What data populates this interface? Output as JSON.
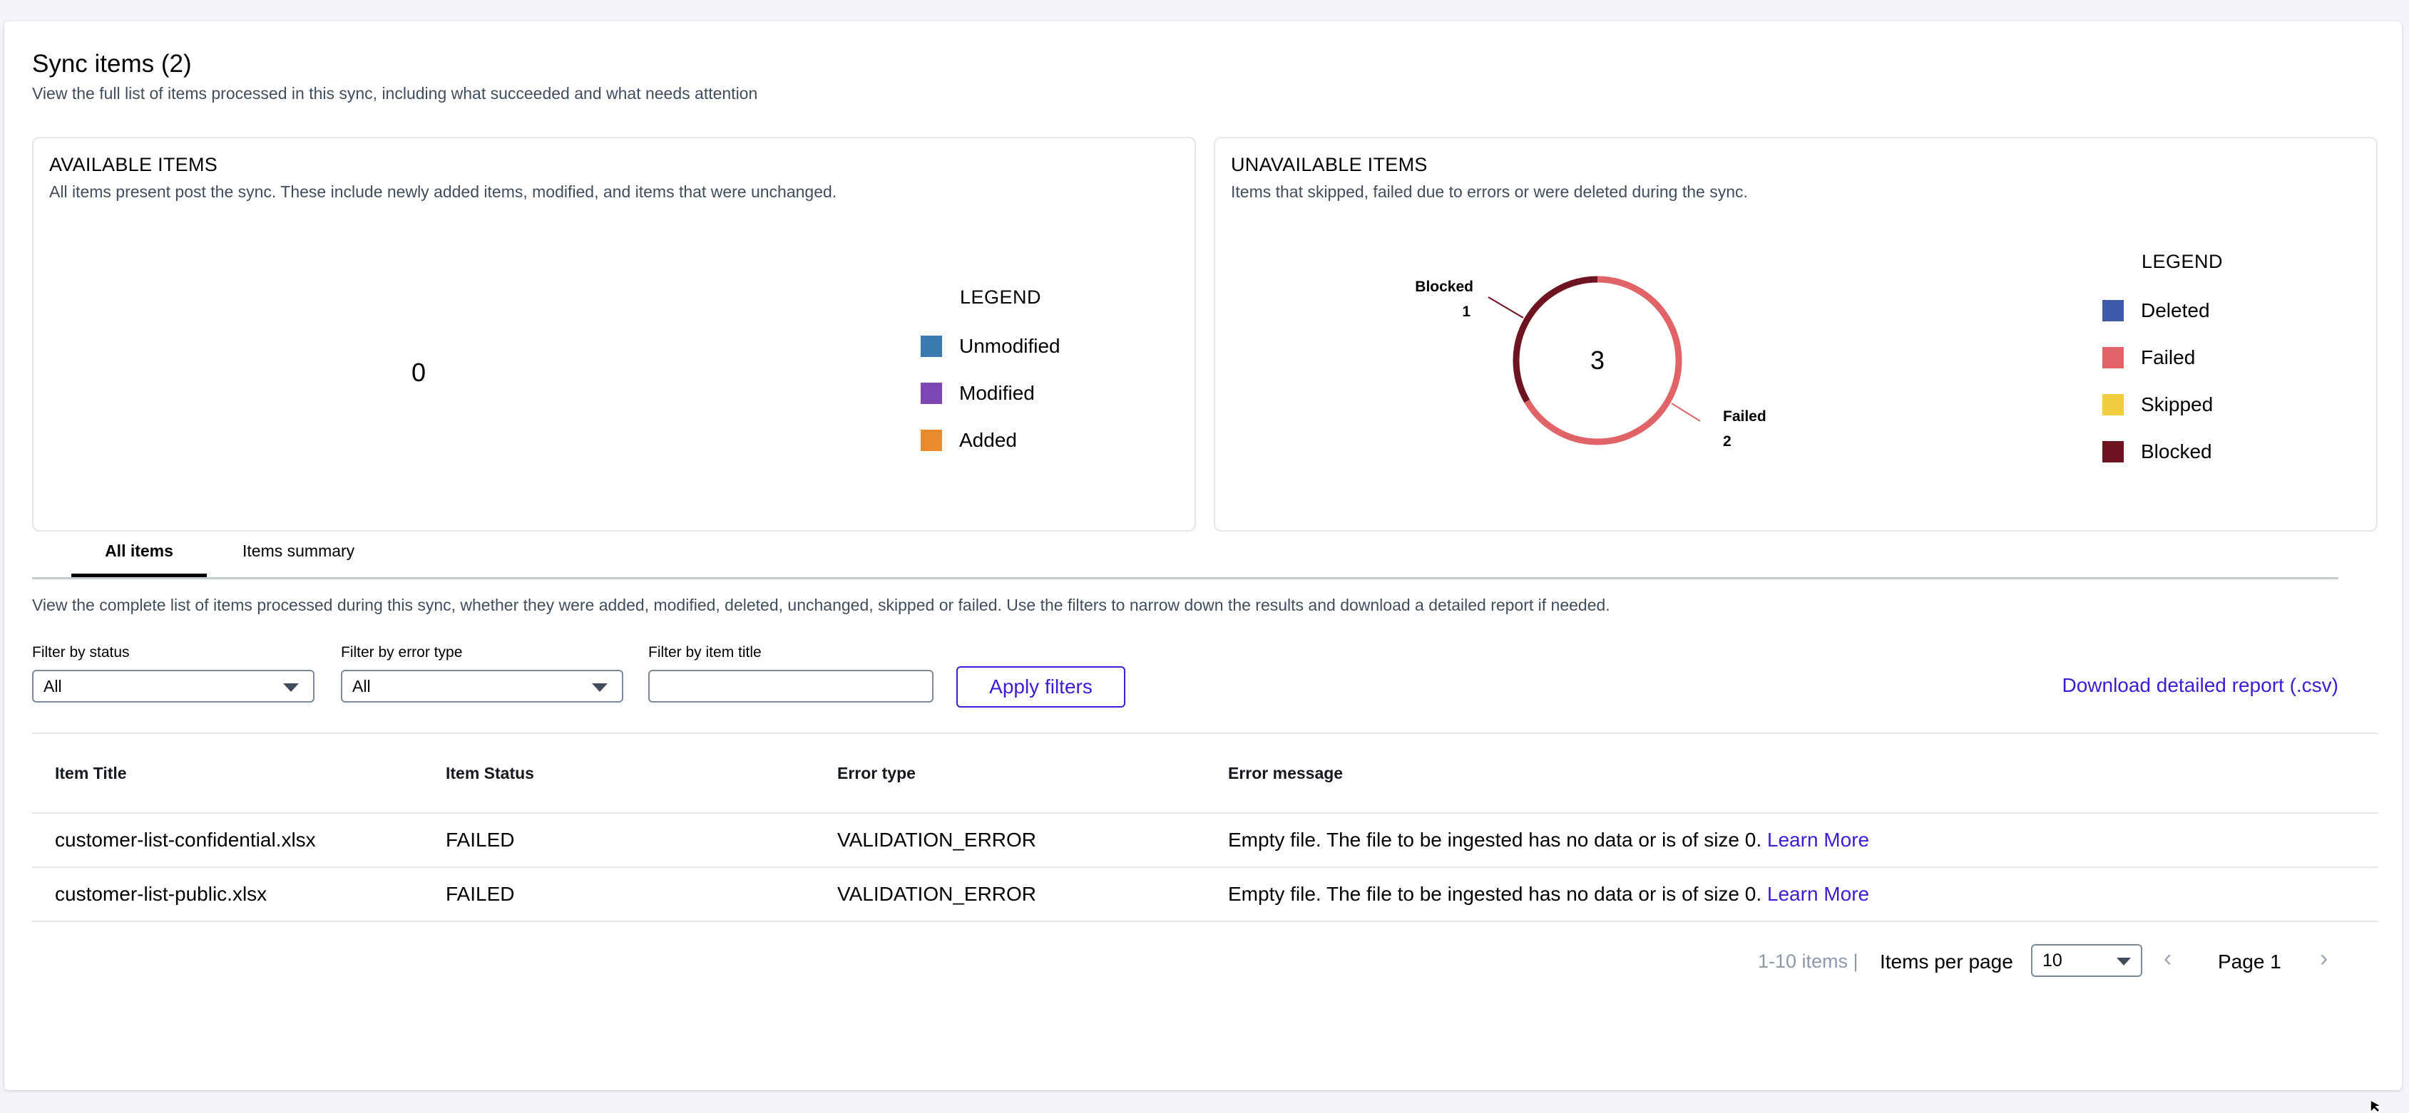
{
  "header": {
    "title": "Sync items (2)",
    "subtitle": "View the full list of items processed in this sync, including what succeeded and what needs attention"
  },
  "available": {
    "heading": "AVAILABLE ITEMS",
    "description": "All items present post the sync. These include newly added items, modified, and items that were unchanged.",
    "total": "0",
    "legend_title": "LEGEND",
    "legend": [
      {
        "label": "Unmodified",
        "color": "#3a79ad"
      },
      {
        "label": "Modified",
        "color": "#7f46b5"
      },
      {
        "label": "Added",
        "color": "#ea8a2e"
      }
    ]
  },
  "unavailable": {
    "heading": "UNAVAILABLE ITEMS",
    "description": "Items that skipped, failed due to errors or were deleted during the sync.",
    "total": "3",
    "legend_title": "LEGEND",
    "legend": [
      {
        "label": "Deleted",
        "color": "#3f5aa8"
      },
      {
        "label": "Failed",
        "color": "#e06467"
      },
      {
        "label": "Skipped",
        "color": "#f2cd40"
      },
      {
        "label": "Blocked",
        "color": "#6e1320"
      }
    ],
    "callouts": {
      "blocked_name": "Blocked",
      "blocked_value": "1",
      "failed_name": "Failed",
      "failed_value": "2"
    }
  },
  "chart_data": {
    "type": "pie",
    "title": "UNAVAILABLE ITEMS",
    "categories": [
      "Deleted",
      "Failed",
      "Skipped",
      "Blocked"
    ],
    "values": [
      0,
      2,
      0,
      1
    ],
    "colors": [
      "#3f5aa8",
      "#e06467",
      "#f2cd40",
      "#6e1320"
    ],
    "center_label": "3",
    "legend_position": "right"
  },
  "tabs": [
    {
      "label": "All items",
      "active": true
    },
    {
      "label": "Items summary",
      "active": false
    }
  ],
  "filters": {
    "description": "View the complete list of items processed during this sync, whether they were added, modified, deleted, unchanged, skipped or failed. Use the filters to narrow down the results and download a detailed report if needed.",
    "status_label": "Filter by status",
    "status_value": "All",
    "error_type_label": "Filter by error type",
    "error_type_value": "All",
    "title_label": "Filter by item title",
    "title_value": "",
    "apply_label": "Apply filters",
    "download_label": "Download detailed report (.csv)"
  },
  "table": {
    "columns": [
      "Item Title",
      "Item Status",
      "Error type",
      "Error message"
    ],
    "rows": [
      {
        "title": "customer-list-confidential.xlsx",
        "status": "FAILED",
        "error_type": "VALIDATION_ERROR",
        "message": "Empty file. The file to be ingested has no data or is of size 0.",
        "link": "Learn More"
      },
      {
        "title": "customer-list-public.xlsx",
        "status": "FAILED",
        "error_type": "VALIDATION_ERROR",
        "message": "Empty file. The file to be ingested has no data or is of size 0.",
        "link": "Learn More"
      }
    ]
  },
  "pagination": {
    "range": "1-10 items |",
    "per_page_label": "Items per page",
    "per_page_value": "10",
    "page_label": "Page 1",
    "prev_icon": "chevron-left-icon",
    "next_icon": "chevron-right-icon"
  }
}
